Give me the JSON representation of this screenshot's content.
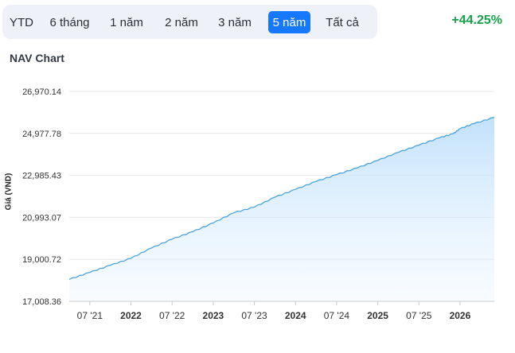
{
  "range_selector": {
    "buttons": [
      {
        "label": "YTD",
        "active": false
      },
      {
        "label": "6 tháng",
        "active": false
      },
      {
        "label": "1 năm",
        "active": false
      },
      {
        "label": "2 năm",
        "active": false
      },
      {
        "label": "3 năm",
        "active": false
      },
      {
        "label": "5 năm",
        "active": true
      },
      {
        "label": "Tất cả",
        "active": false
      }
    ],
    "active_color": "#1677ff"
  },
  "return_value": "+44.25%",
  "return_color": "#17a34a",
  "chart": {
    "title": "NAV Chart"
  },
  "chart_data": {
    "type": "area",
    "title": "NAV Chart",
    "ylabel": "Giá (VND)",
    "xlabel": "",
    "ylim": [
      17008.36,
      26970.14
    ],
    "yticks": [
      "17,008.36",
      "19,000.72",
      "20,993.07",
      "22,985.43",
      "24,977.78",
      "26,970.14"
    ],
    "xticks": [
      "07 '21",
      "2022",
      "07 '22",
      "2023",
      "07 '23",
      "2024",
      "07 '24",
      "2025",
      "07 '25",
      "2026"
    ],
    "xrange": [
      "2021-04",
      "2026-06"
    ],
    "grid": true,
    "line_color": "#4aa3df",
    "series": [
      {
        "x": [
          "2021-04",
          "2021-07",
          "2021-10",
          "2022-01",
          "2022-04",
          "2022-07",
          "2022-10",
          "2023-01",
          "2023-04",
          "2023-07",
          "2023-10",
          "2024-01",
          "2024-04",
          "2024-07",
          "2024-10",
          "2025-01",
          "2025-04",
          "2025-07",
          "2025-10",
          "2025-12",
          "2026-01",
          "2026-03",
          "2026-06"
        ],
        "values": [
          18050,
          18380,
          18720,
          19050,
          19540,
          19960,
          20310,
          20730,
          21210,
          21480,
          21950,
          22320,
          22700,
          23020,
          23340,
          23700,
          24080,
          24420,
          24770,
          24960,
          25200,
          25440,
          25740
        ]
      }
    ]
  }
}
